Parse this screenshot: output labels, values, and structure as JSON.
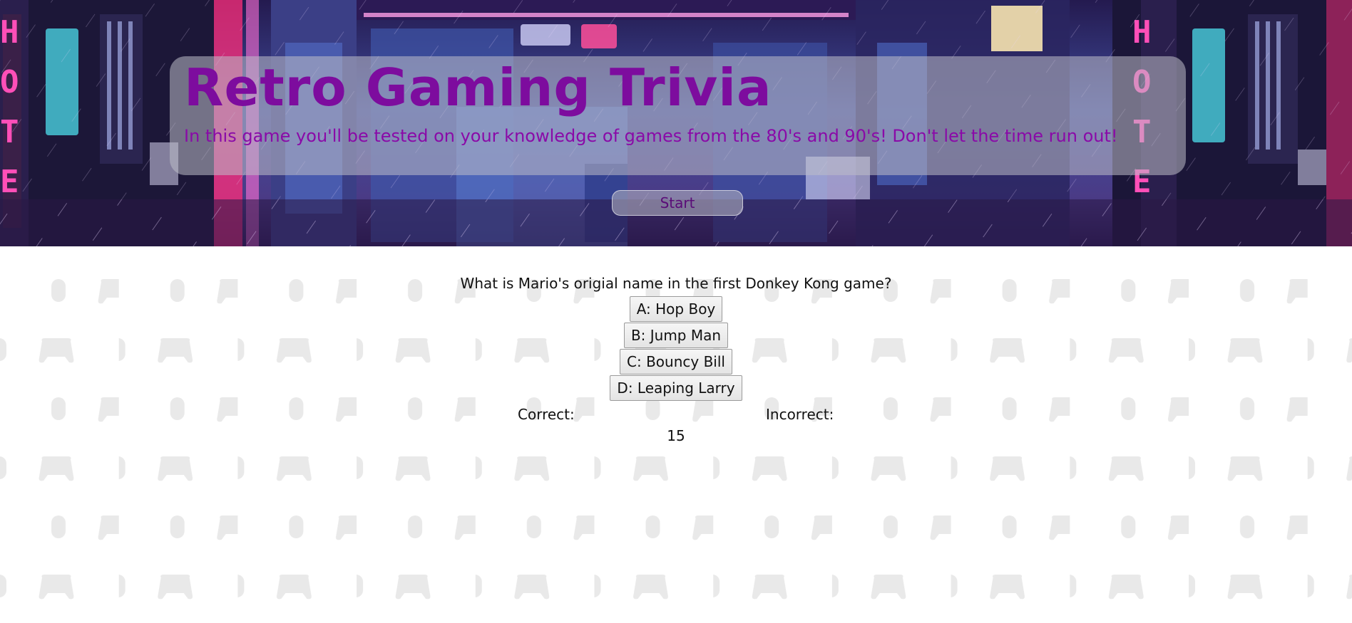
{
  "header": {
    "title": "Retro Gaming Trivia",
    "subtitle": "In this game you'll be tested on your knowledge of games from the 80's and 90's! Don't let the time run out!",
    "start_label": "Start"
  },
  "quiz": {
    "question": "What is Mario's origial name in the first Donkey Kong game?",
    "answers": [
      "A: Hop Boy",
      "B: Jump Man",
      "C: Bouncy Bill",
      "D: Leaping Larry"
    ]
  },
  "score": {
    "correct_label": "Correct:",
    "incorrect_label": "Incorrect:"
  },
  "timer": {
    "value": "15"
  },
  "colors": {
    "title": "#7d0c9e",
    "subtitle": "#8a0aa8",
    "pattern_icon": "#e9e9e9"
  },
  "background_pattern_icons": [
    "mouse-icon",
    "gamepad-icon"
  ]
}
